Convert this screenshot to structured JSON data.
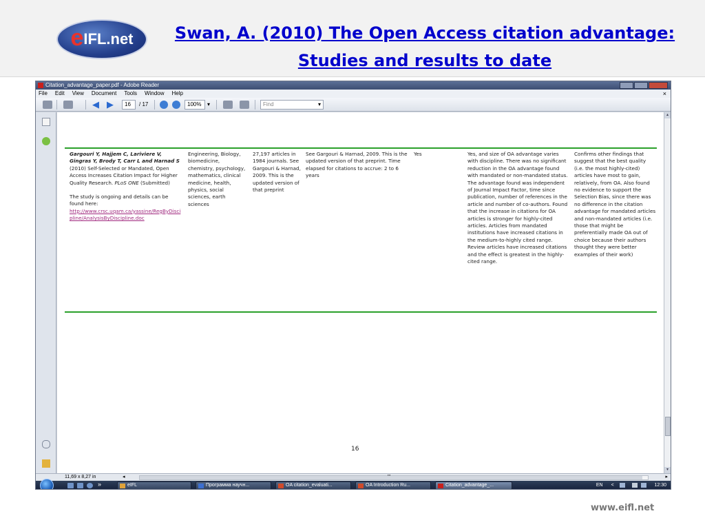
{
  "slide": {
    "logo_e": "e",
    "logo_rest": "IFL.net",
    "title_line1": "Swan, A. (2010) The Open Access citation advantage:",
    "title_line2": "Studies and results to date",
    "footer_url": "www.eifl.net"
  },
  "window": {
    "title": "Citation_advantage_paper.pdf - Adobe Reader",
    "menu": [
      "File",
      "Edit",
      "View",
      "Document",
      "Tools",
      "Window",
      "Help"
    ],
    "menu_close": "×",
    "toolbar": {
      "page_current": "16",
      "page_total": "/ 17",
      "zoom": "100%",
      "zoom_arrow": "▾",
      "find_placeholder": "Find",
      "find_arrow": "▾"
    }
  },
  "document": {
    "row": {
      "reference_authors": "Gargouri Y, Hajjem C, Lariviere V, Gingras Y, Brody T, Carr L and Harnad S",
      "reference_year": " (2010) Self-Selected or Mandated, Open Access Increases Citation Impact for Higher Quality Research. ",
      "reference_journal": "PLoS ONE",
      "reference_status": " (Submitted)",
      "reference_note": "The study is ongoing and details can be found here:",
      "reference_link": "http://www.crsc.uqam.ca/yassine/RegByDiscipline/AnalysisByDiscipline.doc",
      "disciplines": "Engineering, Biology, biomedicine, chemistry, psychology, mathematics, clinical medicine, health, physics, social sciences, earth sciences",
      "sample": "27,197 articles in 1984 journals. See Gargouri & Harnad, 2009. This is the updated version of that preprint",
      "method": "See Gargouri & Harnad, 2009. This is the updated version of that preprint. Time elapsed for citations to accrue: 2 to 6 years",
      "advantage": "Yes",
      "findings": "Yes, and size of OA advantage varies with discipline. There was no significant reduction in the OA advantage found with mandated or non-mandated status. The advantage found was independent of Journal Impact Factor, time since publication, number of references in the article and number of co-authors. Found that the increase in citations for OA articles is stronger for highly-cited articles. Articles from mandated institutions have increased citations in the medium-to-highly cited range. Review articles have increased citations and the effect is greatest in the highly-cited range.",
      "comments": "Confirms other findings that suggest that the best quality (i.e. the most highly-cited) articles have most to gain, relatively, from OA. Also found no evidence to support the Selection Bias, since there was no difference in the citation advantage for mandated articles and non-mandated articles (i.e. those that might be preferentially made OA out of choice because their authors thought they were better examples of their work)"
    },
    "page_number": "16"
  },
  "statusbar": {
    "page_size": "11,69 x 8,27 in",
    "scroll_left": "◂",
    "scroll_right": "▸",
    "hscroll_grip": "'''"
  },
  "taskbar": {
    "chevron": "»",
    "tasks": [
      {
        "label": "eIFL"
      },
      {
        "label": "Программа научн..."
      },
      {
        "label": "OA citation_evaluati..."
      },
      {
        "label": "OA Introduction Ru..."
      },
      {
        "label": "Citation_advantage_..."
      }
    ],
    "tray_lang": "EN",
    "tray_arrow": "<",
    "clock": "12:30"
  }
}
